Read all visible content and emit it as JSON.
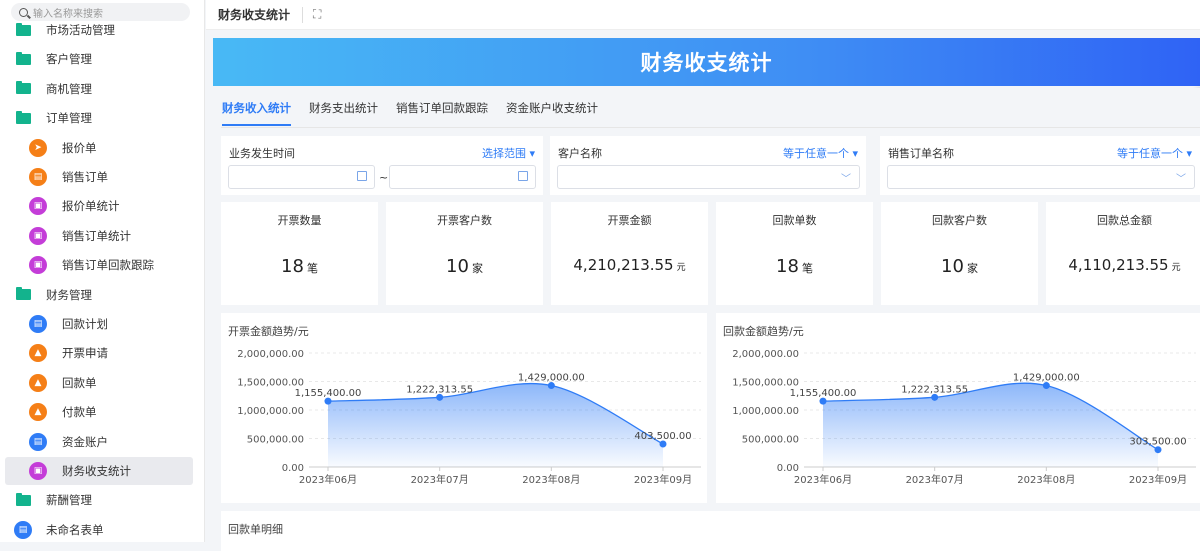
{
  "sidebar": {
    "search_placeholder": "输入名称来搜索",
    "items": [
      {
        "label": "市场活动管理",
        "type": "folder"
      },
      {
        "label": "客户管理",
        "type": "folder"
      },
      {
        "label": "商机管理",
        "type": "folder"
      },
      {
        "label": "订单管理",
        "type": "folder"
      },
      {
        "label": "报价单",
        "type": "orange",
        "icon": "send-icon"
      },
      {
        "label": "销售订单",
        "type": "orange",
        "icon": "form-icon"
      },
      {
        "label": "报价单统计",
        "type": "purple",
        "icon": "chart-icon"
      },
      {
        "label": "销售订单统计",
        "type": "purple",
        "icon": "chart-icon"
      },
      {
        "label": "销售订单回款跟踪",
        "type": "purple",
        "icon": "chart-icon"
      },
      {
        "label": "财务管理",
        "type": "folder"
      },
      {
        "label": "回款计划",
        "type": "blue",
        "icon": "doc-icon"
      },
      {
        "label": "开票申请",
        "type": "orange",
        "icon": "clipboard-icon"
      },
      {
        "label": "回款单",
        "type": "orange",
        "icon": "clipboard-icon"
      },
      {
        "label": "付款单",
        "type": "orange",
        "icon": "clipboard-icon"
      },
      {
        "label": "资金账户",
        "type": "blue",
        "icon": "doc-icon"
      },
      {
        "label": "财务收支统计",
        "type": "purple",
        "icon": "chart-icon",
        "active": true
      },
      {
        "label": "薪酬管理",
        "type": "folder"
      },
      {
        "label": "未命名表单",
        "type": "blue-top",
        "icon": "doc-icon"
      }
    ]
  },
  "topbar": {
    "title": "财务收支统计"
  },
  "banner": {
    "title": "财务收支统计"
  },
  "tabs": [
    {
      "label": "财务收入统计",
      "active": true
    },
    {
      "label": "财务支出统计"
    },
    {
      "label": "销售订单回款跟踪"
    },
    {
      "label": "资金账户收支统计"
    }
  ],
  "filters": {
    "time": {
      "label": "业务发生时间",
      "op": "选择范围",
      "sep": "~"
    },
    "customer": {
      "label": "客户名称",
      "op": "等于任意一个"
    },
    "order": {
      "label": "销售订单名称",
      "op": "等于任意一个"
    }
  },
  "stats": [
    {
      "label": "开票数量",
      "value": "18",
      "unit": "笔"
    },
    {
      "label": "开票客户数",
      "value": "10",
      "unit": "家"
    },
    {
      "label": "开票金额",
      "value": "4,210,213.55",
      "unit": "元",
      "money": true
    },
    {
      "label": "回款单数",
      "value": "18",
      "unit": "笔"
    },
    {
      "label": "回款客户数",
      "value": "10",
      "unit": "家"
    },
    {
      "label": "回款总金额",
      "value": "4,110,213.55",
      "unit": "元",
      "money": true
    }
  ],
  "chart_data": [
    {
      "type": "area",
      "title": "开票金额趋势/元",
      "categories": [
        "2023年06月",
        "2023年07月",
        "2023年08月",
        "2023年09月"
      ],
      "values": [
        1155400.0,
        1222313.55,
        1429000.0,
        403500.0
      ],
      "labels": [
        "1,155,400.00",
        "1,222,313.55",
        "1,429,000.00",
        "403,500.00"
      ],
      "yticks": [
        "0.00",
        "500,000.00",
        "1,000,000.00",
        "1,500,000.00",
        "2,000,000.00"
      ],
      "ylim": [
        0,
        2000000
      ],
      "color": "#2f7cf6"
    },
    {
      "type": "area",
      "title": "回款金额趋势/元",
      "categories": [
        "2023年06月",
        "2023年07月",
        "2023年08月",
        "2023年09月"
      ],
      "values": [
        1155400.0,
        1222313.55,
        1429000.0,
        303500.0
      ],
      "labels": [
        "1,155,400.00",
        "1,222,313.55",
        "1,429,000.00",
        "303,500.00"
      ],
      "yticks": [
        "0.00",
        "500,000.00",
        "1,000,000.00",
        "1,500,000.00",
        "2,000,000.00"
      ],
      "ylim": [
        0,
        2000000
      ],
      "color": "#2f7cf6"
    }
  ],
  "detail": {
    "title": "回款单明细"
  }
}
